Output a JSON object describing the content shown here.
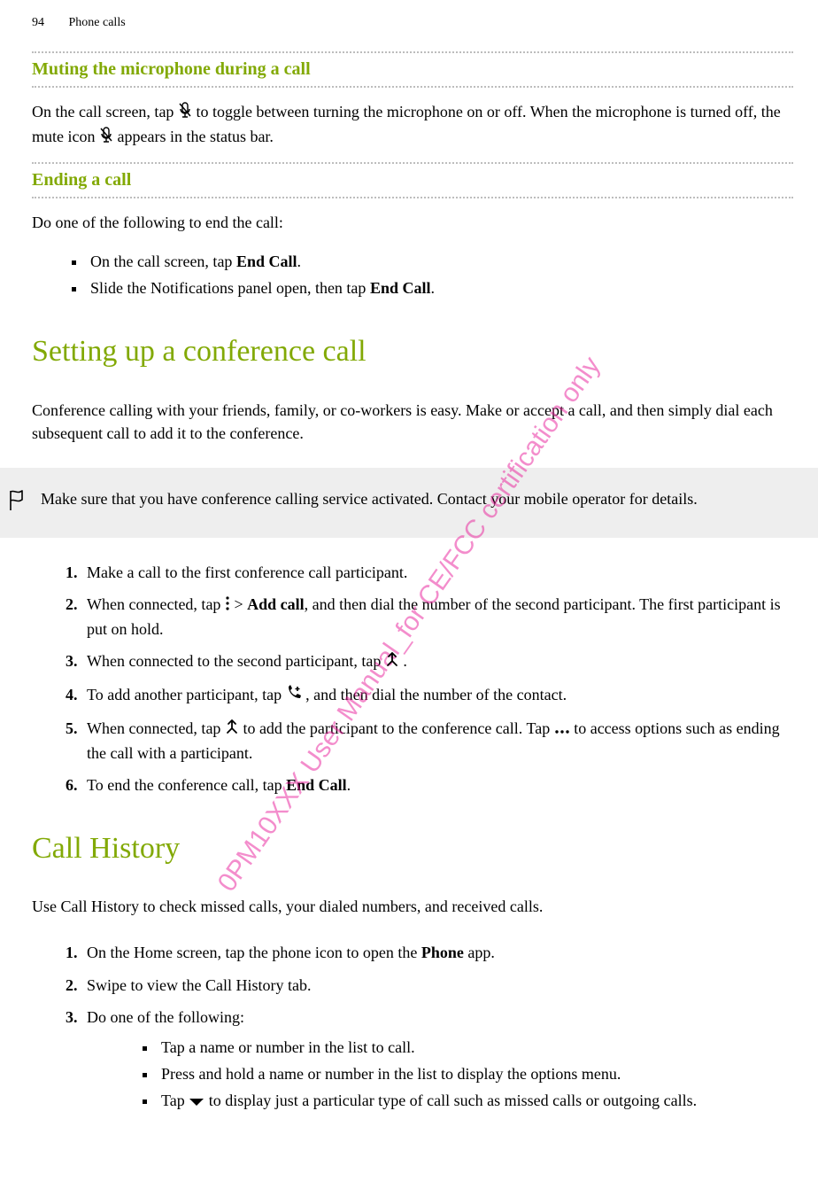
{
  "page_number": "94",
  "running_title": "Phone calls",
  "watermark_text": "0PM10XXX User Manual_for CE/FCC certification only",
  "muting": {
    "heading": "Muting the microphone during a call",
    "p1_a": "On the call screen, tap ",
    "p1_b": " to toggle between turning the microphone on or off. When the microphone is turned off, the mute icon ",
    "p1_c": " appears in the status bar."
  },
  "ending": {
    "heading": "Ending a call",
    "intro": "Do one of the following to end the call:",
    "items": [
      {
        "a": "On the call screen, tap ",
        "bold": "End Call",
        "b": "."
      },
      {
        "a": "Slide the Notifications panel open, then tap ",
        "bold": "End Call",
        "b": "."
      }
    ]
  },
  "conference": {
    "heading": "Setting up a conference call",
    "intro": "Conference calling with your friends, family, or co-workers is easy. Make or accept a call, and then simply dial each subsequent call to add it to the conference.",
    "note": "Make sure that you have conference calling service activated. Contact your mobile operator for details.",
    "steps": {
      "s1": "Make a call to the first conference call participant.",
      "s2_a": "When connected, tap ",
      "s2_gt": " > ",
      "s2_bold": "Add call",
      "s2_b": ", and then dial the number of the second participant. The first participant is put on hold.",
      "s3_a": "When connected to the second participant, tap ",
      "s3_b": " .",
      "s4_a": "To add another participant, tap ",
      "s4_b": " , and then dial the number of the contact.",
      "s5_a": "When connected, tap ",
      "s5_b": " to add the participant to the conference call. Tap ",
      "s5_c": " to access options such as ending the call with a participant.",
      "s6_a": "To end the conference call, tap ",
      "s6_bold": "End Call",
      "s6_b": "."
    }
  },
  "history": {
    "heading": "Call History",
    "intro": "Use Call History to check missed calls, your dialed numbers, and received calls.",
    "steps": {
      "s1_a": "On the Home screen, tap the phone icon to open the ",
      "s1_bold": "Phone",
      "s1_b": " app.",
      "s2": "Swipe to view the Call History tab.",
      "s3_intro": "Do one of the following:",
      "s3_items": {
        "i1": "Tap a name or number in the list to call.",
        "i2": "Press and hold a name or number in the list to display the options menu.",
        "i3_a": "Tap ",
        "i3_b": " to display just a particular type of call such as missed calls or outgoing calls."
      }
    }
  }
}
